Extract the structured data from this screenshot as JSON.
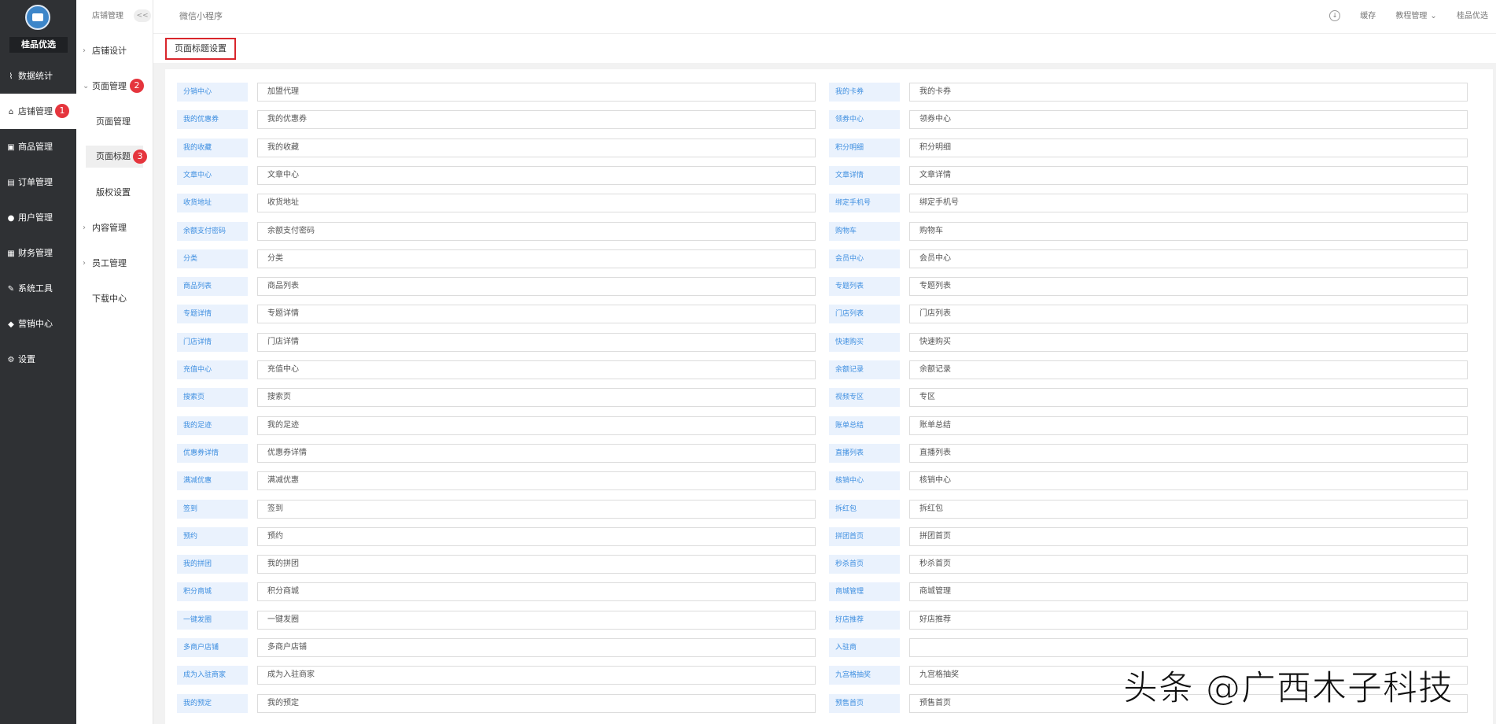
{
  "app": {
    "brand": "桂品优选",
    "breadcrumb": "微信小程序"
  },
  "topbar": {
    "cache": "缓存",
    "tutorial": "教程管理",
    "user": "桂品优选"
  },
  "sidebar": {
    "items": [
      {
        "label": "数据统计",
        "icon": "chart-icon"
      },
      {
        "label": "店铺管理",
        "icon": "store-icon",
        "active": true,
        "badge": "1"
      },
      {
        "label": "商品管理",
        "icon": "goods-icon"
      },
      {
        "label": "订单管理",
        "icon": "order-icon"
      },
      {
        "label": "用户管理",
        "icon": "user-icon"
      },
      {
        "label": "财务管理",
        "icon": "finance-icon"
      },
      {
        "label": "系统工具",
        "icon": "wrench-icon"
      },
      {
        "label": "营销中心",
        "icon": "marketing-icon"
      },
      {
        "label": "设置",
        "icon": "gear-icon"
      }
    ]
  },
  "subnav": {
    "header": "店铺管理",
    "collapse": "<<",
    "items": [
      {
        "label": "店铺设计",
        "chevron": ">"
      },
      {
        "label": "页面管理",
        "chevron": "v",
        "badge": "2"
      },
      {
        "label": "页面管理"
      },
      {
        "label": "页面标题",
        "badge": "3",
        "selected": true
      },
      {
        "label": "版权设置"
      },
      {
        "label": "内容管理",
        "chevron": ">"
      },
      {
        "label": "员工管理",
        "chevron": ">"
      },
      {
        "label": "下载中心"
      }
    ]
  },
  "tab": {
    "label": "页面标题设置"
  },
  "form": {
    "left": [
      {
        "label": "分销中心",
        "value": "加盟代理"
      },
      {
        "label": "我的优惠券",
        "value": "我的优惠券"
      },
      {
        "label": "我的收藏",
        "value": "我的收藏"
      },
      {
        "label": "文章中心",
        "value": "文章中心"
      },
      {
        "label": "收货地址",
        "value": "收货地址"
      },
      {
        "label": "余额支付密码",
        "value": "余额支付密码"
      },
      {
        "label": "分类",
        "value": "分类"
      },
      {
        "label": "商品列表",
        "value": "商品列表"
      },
      {
        "label": "专题详情",
        "value": "专题详情"
      },
      {
        "label": "门店详情",
        "value": "门店详情"
      },
      {
        "label": "充值中心",
        "value": "充值中心"
      },
      {
        "label": "搜索页",
        "value": "搜索页"
      },
      {
        "label": "我的足迹",
        "value": "我的足迹"
      },
      {
        "label": "优惠券详情",
        "value": "优惠券详情"
      },
      {
        "label": "满减优惠",
        "value": "满减优惠"
      },
      {
        "label": "签到",
        "value": "签到"
      },
      {
        "label": "预约",
        "value": "预约"
      },
      {
        "label": "我的拼团",
        "value": "我的拼团"
      },
      {
        "label": "积分商城",
        "value": "积分商城"
      },
      {
        "label": "一键发圈",
        "value": "一键发圈"
      },
      {
        "label": "多商户店铺",
        "value": "多商户店铺"
      },
      {
        "label": "成为入驻商家",
        "value": "成为入驻商家"
      },
      {
        "label": "我的预定",
        "value": "我的预定"
      }
    ],
    "right": [
      {
        "label": "我的卡券",
        "value": "我的卡券"
      },
      {
        "label": "领券中心",
        "value": "领券中心"
      },
      {
        "label": "积分明细",
        "value": "积分明细"
      },
      {
        "label": "文章详情",
        "value": "文章详情"
      },
      {
        "label": "绑定手机号",
        "value": "绑定手机号"
      },
      {
        "label": "购物车",
        "value": "购物车"
      },
      {
        "label": "会员中心",
        "value": "会员中心"
      },
      {
        "label": "专题列表",
        "value": "专题列表"
      },
      {
        "label": "门店列表",
        "value": "门店列表"
      },
      {
        "label": "快速购买",
        "value": "快速购买"
      },
      {
        "label": "余额记录",
        "value": "余额记录"
      },
      {
        "label": "视频专区",
        "value": "专区"
      },
      {
        "label": "账单总结",
        "value": "账单总结"
      },
      {
        "label": "直播列表",
        "value": "直播列表"
      },
      {
        "label": "核销中心",
        "value": "核销中心"
      },
      {
        "label": "拆红包",
        "value": "拆红包"
      },
      {
        "label": "拼团首页",
        "value": "拼团首页"
      },
      {
        "label": "秒杀首页",
        "value": "秒杀首页"
      },
      {
        "label": "商城管理",
        "value": "商城管理"
      },
      {
        "label": "好店推荐",
        "value": "好店推荐"
      },
      {
        "label": "入驻商",
        "value": ""
      },
      {
        "label": "九宫格抽奖",
        "value": "九宫格抽奖"
      },
      {
        "label": "预售首页",
        "value": "预售首页"
      }
    ]
  },
  "watermark": "头条 @广西木子科技",
  "colors": {
    "sidebar": "#2f3134",
    "accent": "#3d8ee0",
    "badge": "#e5353d"
  }
}
